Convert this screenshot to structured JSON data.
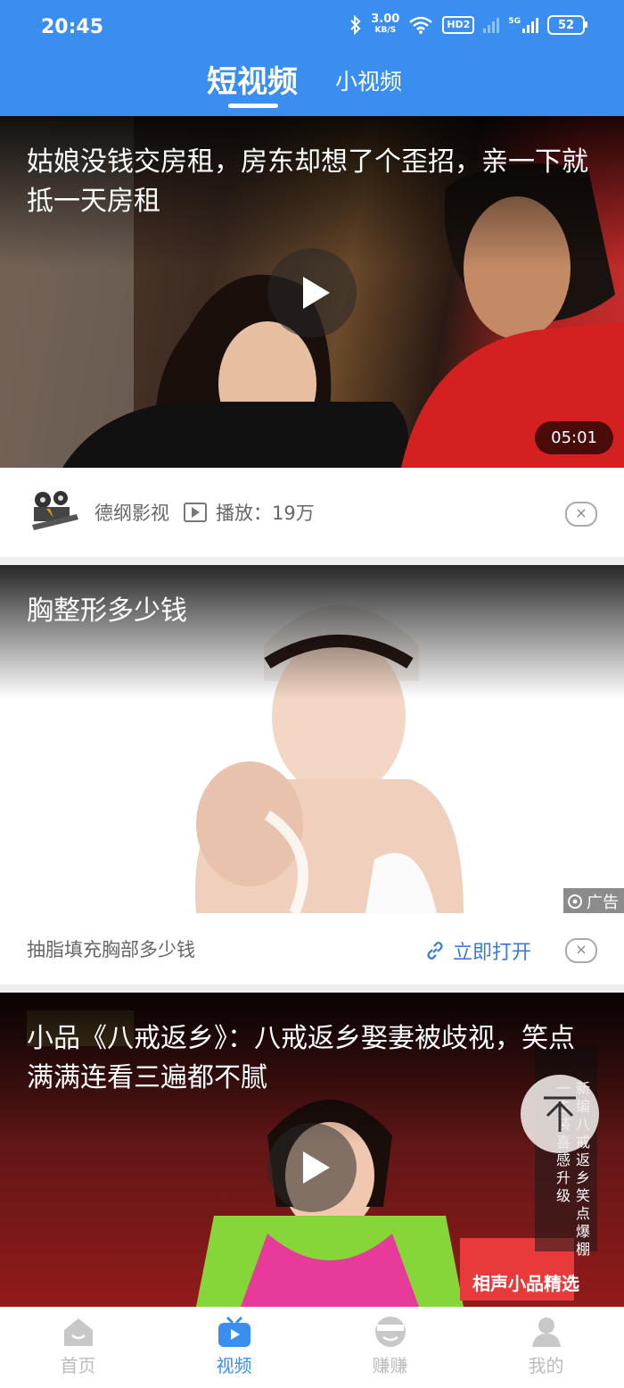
{
  "status": {
    "time": "20:45",
    "speed": "3.00",
    "speed_unit": "KB/S",
    "hd": "HD2",
    "net": "5G",
    "battery": "52"
  },
  "tabs": {
    "active": "短视频",
    "other": "小视频"
  },
  "feed": [
    {
      "title": "姑娘没钱交房租，房东却想了个歪招，亲一下就抵一天房租",
      "duration": "05:01",
      "author": "德纲影视",
      "plays": "播放：19万"
    },
    {
      "title": "胸整形多少钱",
      "ad_label": "广告",
      "ad_text": "抽脂填充胸部多少钱",
      "ad_action": "立即打开"
    },
    {
      "title": "小品《八戒返乡》：八戒返乡娶妻被歧视，笑点满满连看三遍都不腻",
      "side_text": "新编八戒返乡笑点爆棚",
      "side_text2": "一古装喜感升级",
      "banner": "相声小品精选"
    }
  ],
  "close_symbol": "×",
  "nav": [
    {
      "label": "首页"
    },
    {
      "label": "视频"
    },
    {
      "label": "赚赚"
    },
    {
      "label": "我的"
    }
  ]
}
